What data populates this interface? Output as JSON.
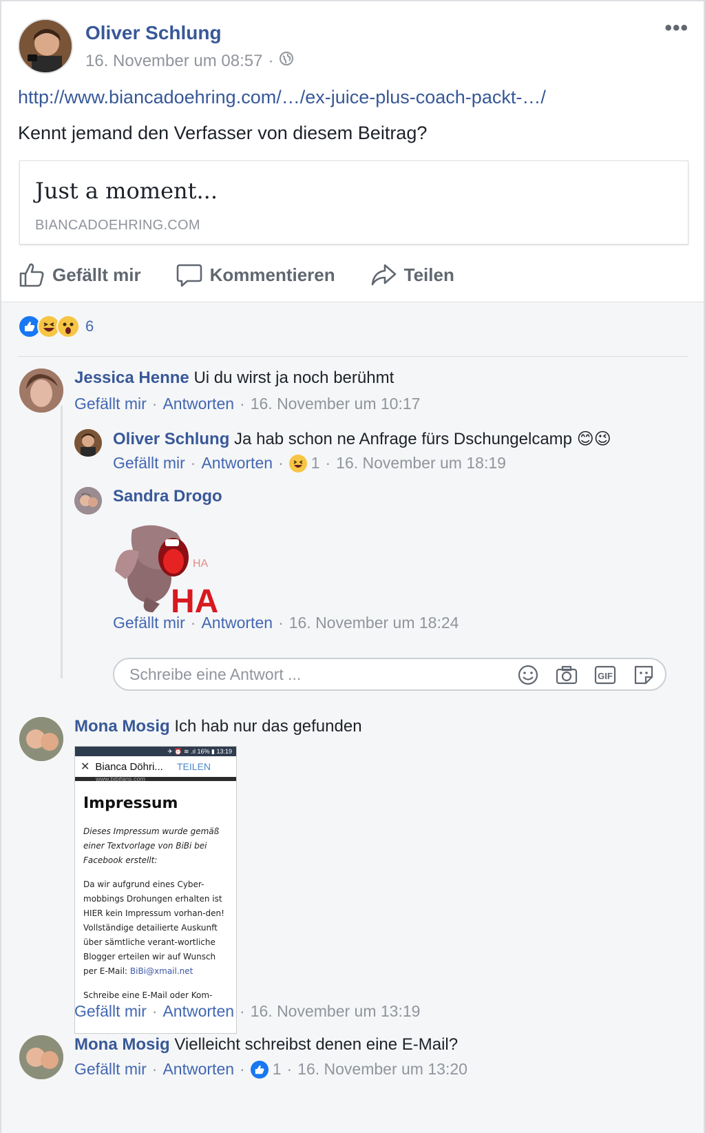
{
  "post": {
    "author": "Oliver Schlung",
    "timestamp": "16. November um 08:57",
    "link": "http://www.biancadoehring.com/…/ex-juice-plus-coach-packt-…/",
    "text": "Kennt jemand den Verfasser von diesem Beitrag?",
    "preview": {
      "title": "Just a moment...",
      "domain": "BIANCADOEHRING.COM"
    },
    "actions": {
      "like": "Gefällt mir",
      "comment": "Kommentieren",
      "share": "Teilen"
    },
    "reaction_count": "6"
  },
  "labels": {
    "like": "Gefällt mir",
    "reply": "Antworten",
    "dot": "·"
  },
  "comments": [
    {
      "author": "Jessica Henne",
      "text": "Ui du wirst ja noch berühmt",
      "timestamp": "16. November um 10:17"
    },
    {
      "author": "Oliver Schlung",
      "text": "Ja hab schon ne Anfrage fürs Dschungelcamp",
      "emoji": "😊😉",
      "reaction_count": "1",
      "timestamp": "16. November um 18:19"
    },
    {
      "author": "Sandra Drogo",
      "sticker_text": "HA",
      "sticker_text_small": "HA",
      "timestamp": "16. November um 18:24"
    },
    {
      "author": "Mona Mosig",
      "text": "Ich hab nur das gefunden",
      "timestamp": "16. November um 13:19"
    },
    {
      "author": "Mona Mosig",
      "text": "Vielleicht schreibst denen eine E-Mail?",
      "reaction_count": "1",
      "timestamp": "16. November um 13:20"
    }
  ],
  "reply_box": {
    "placeholder": "Schreibe eine Antwort ..."
  },
  "screenshot": {
    "status": "✈ ⏰ ≋ .ıl 16% ▮ 13:19",
    "tab_title": "Bianca Döhri...",
    "tab_url": "www.bibifans.com",
    "share": "TEILEN",
    "heading": "Impressum",
    "italic": "Dieses Impressum wurde gemäß einer Textvorlage von BiBi bei Facebook erstellt:",
    "body": "Da wir aufgrund eines Cyber-mobbings Drohungen erhalten ist HIER kein Impressum vorhan-den! Vollständige detailierte Auskunft über sämtliche verant-wortliche Blogger erteilen wir auf Wunsch per E-Mail:",
    "email": "BiBi@xmail.net",
    "footer": "Schreibe eine E-Mail oder Kom-"
  },
  "colors": {
    "brand": "#385898",
    "like_blue": "#1877f2",
    "meta_gray": "#90949c"
  }
}
